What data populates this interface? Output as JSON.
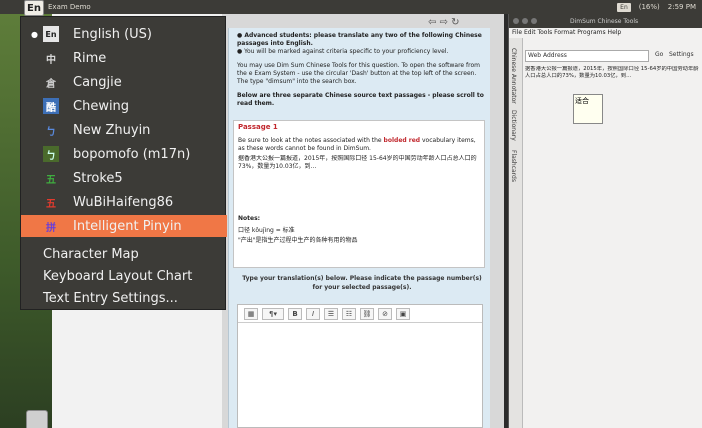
{
  "topbar": {
    "indicator": "En",
    "app_title": "Exam Demo",
    "input_badge": "En",
    "battery": "(16%)",
    "time": "2:59 PM"
  },
  "ime_menu": {
    "items": [
      {
        "label": "English (US)",
        "icon": "En",
        "icon_name": "english-layout-icon",
        "checked": true
      },
      {
        "label": "Rime",
        "icon": "中",
        "icon_name": "rime-icon"
      },
      {
        "label": "Cangjie",
        "icon": "倉",
        "icon_name": "cangjie-icon"
      },
      {
        "label": "Chewing",
        "icon": "酷",
        "icon_name": "chewing-icon"
      },
      {
        "label": "New Zhuyin",
        "icon": "ㄅ",
        "icon_name": "new-zhuyin-icon"
      },
      {
        "label": "bopomofo (m17n)",
        "icon": "ㄅ",
        "icon_name": "bopomofo-icon"
      },
      {
        "label": "Stroke5",
        "icon": "五",
        "icon_name": "stroke5-icon"
      },
      {
        "label": "WuBiHaifeng86",
        "icon": "五",
        "icon_name": "wubi-icon"
      },
      {
        "label": "Intelligent Pinyin",
        "icon": "拼",
        "icon_name": "intelligent-pinyin-icon",
        "active": true
      }
    ],
    "actions": [
      {
        "label": "Character Map"
      },
      {
        "label": "Keyboard Layout Chart"
      },
      {
        "label": "Text Entry Settings..."
      }
    ]
  },
  "page": {
    "intro_1": "● Advanced students: please translate any two of the following Chinese passages into English.",
    "intro_2": "● You will be marked against criteria specific to your proficiency level.",
    "intro_3": "You may use Dim Sum Chinese Tools for this question. To open the software from the e Exam System - use the circular 'Dash' button at the top left of the screen. The type \"dimsum\" into the search box.",
    "intro_4": "Below are three separate Chinese source text passages - please scroll to read them.",
    "passage_title": "Passage 1",
    "passage_note_pre": "Be sure to look at the notes associated with the ",
    "passage_note_red": "bolded red",
    "passage_note_post": " vocabulary items, as these words cannot be found in DimSum.",
    "passage_text": "据香港大公报一篇报道，2015年，按照国际口径 15-64岁的中国劳动年龄人口占总人口的73%，数量为10.03亿，到…",
    "notes_title": "Notes:",
    "note_1": "口径 kǒujìng = 标准",
    "note_2": "\"产出\"是指生产过程中生产的各种有用的物品",
    "translation_instruction": "Type your translation(s) below. Please indicate the passage number(s) for your selected passage(s).",
    "editor_value": ""
  },
  "dimsum": {
    "title": "DimSum Chinese Tools",
    "menu": "File Edit Tools Format Programs Help",
    "tabs": [
      "Chinese Annotator",
      "Dictionary",
      "Flashcards"
    ],
    "web_address_label": "Web Address",
    "go_label": "Go",
    "settings_label": "Settings",
    "content": "据香港大公报一篇报道，2015年，按照国际口径 15-64岁的中国劳动年龄人口占总人口的73%，数量为10.03亿，到…",
    "popup_word": "适合"
  }
}
